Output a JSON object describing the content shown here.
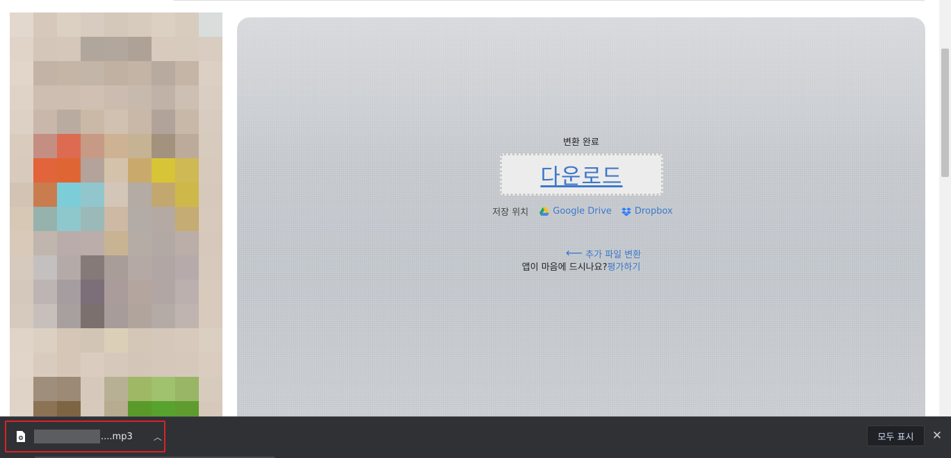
{
  "main": {
    "status_text": "변환 완료",
    "download_label": "다운로드",
    "save_to_label": "저장 위치",
    "google_drive_label": "Google Drive",
    "dropbox_label": "Dropbox",
    "convert_more_label": "추가 파일 변환",
    "rate_prompt": "앱이 마음에 드시나요?",
    "rate_link": "평가하기",
    "accent_color": "#3e78c9"
  },
  "download_shelf": {
    "file_name_suffix": "....mp3",
    "show_all_label": "모두 표시",
    "close_glyph": "✕",
    "menu_glyph": "︿",
    "highlight_color": "#d9232a"
  },
  "icons": {
    "file": "audio-file-icon",
    "drive": "google-drive-icon",
    "dropbox": "dropbox-icon",
    "arrow": "arrow-left-icon"
  }
}
